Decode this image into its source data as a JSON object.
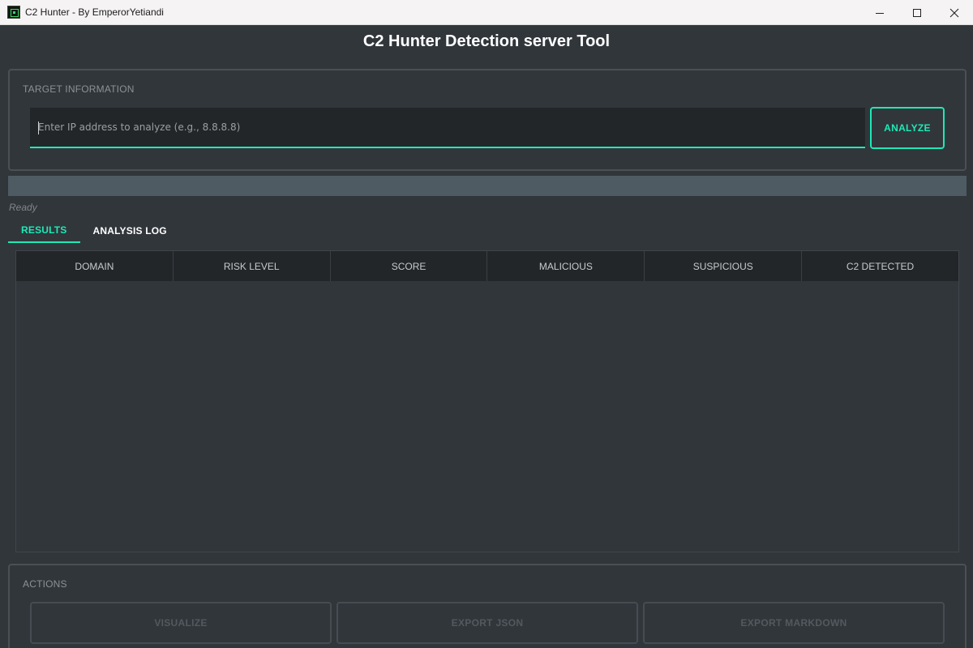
{
  "window": {
    "title": "C2 Hunter - By EmperorYetiandi",
    "icon": "app-icon",
    "controls": [
      "minimize-icon",
      "maximize-icon",
      "close-icon"
    ]
  },
  "header": {
    "title": "C2 Hunter Detection server Tool"
  },
  "target": {
    "label": "TARGET INFORMATION",
    "ip_value": "",
    "ip_placeholder": "Enter IP address to analyze (e.g., 8.8.8.8)",
    "analyze_label": "ANALYZE"
  },
  "progress": {
    "value": 0
  },
  "status": {
    "text": "Ready"
  },
  "tabs": [
    {
      "label": "RESULTS",
      "active": true
    },
    {
      "label": "ANALYSIS LOG",
      "active": false
    }
  ],
  "results_table": {
    "columns": [
      "DOMAIN",
      "RISK LEVEL",
      "SCORE",
      "MALICIOUS",
      "SUSPICIOUS",
      "C2 DETECTED"
    ],
    "rows": []
  },
  "actions": {
    "label": "ACTIONS",
    "buttons": [
      "VISUALIZE",
      "EXPORT JSON",
      "EXPORT MARKDOWN"
    ]
  },
  "colors": {
    "accent": "#1de9b6",
    "background": "#31363b",
    "input_background": "#232629",
    "progress_track": "#4f5b62"
  }
}
